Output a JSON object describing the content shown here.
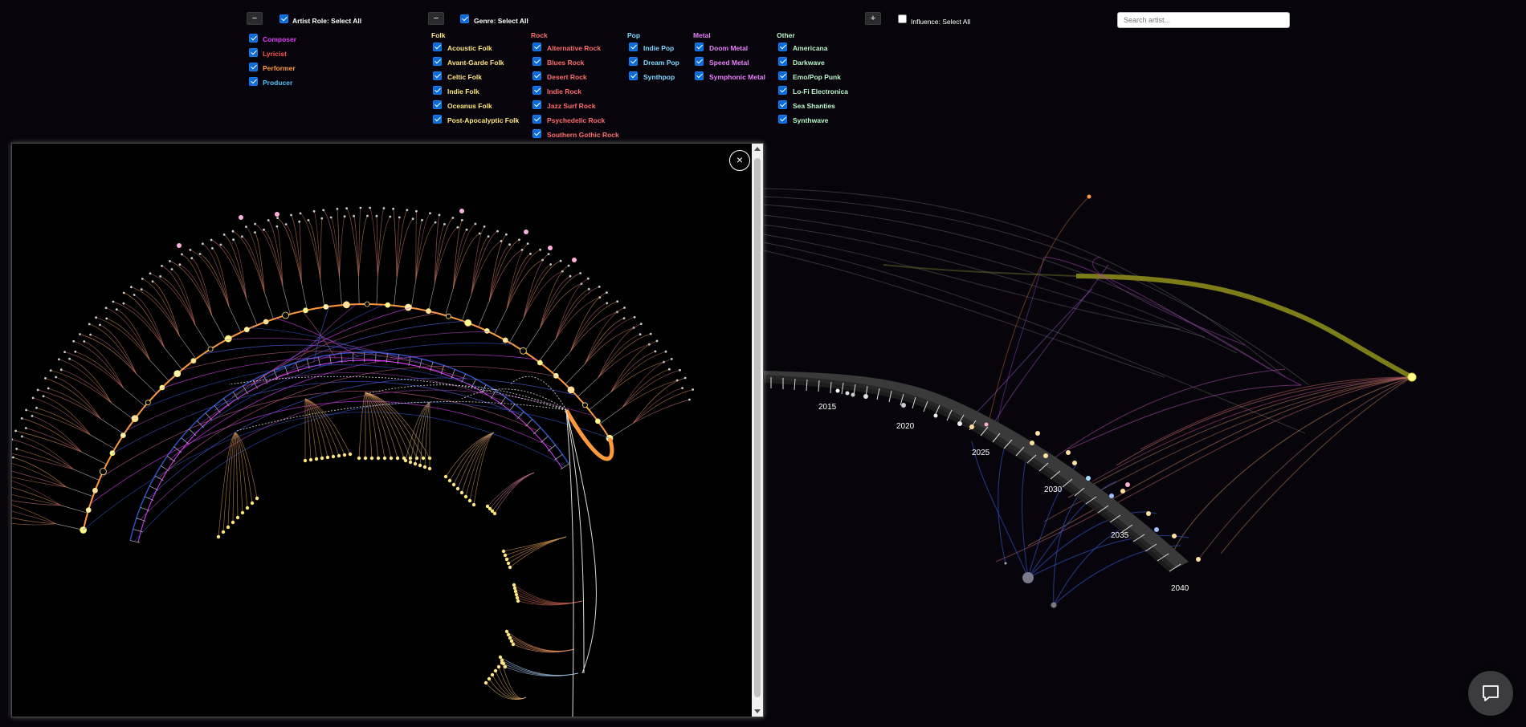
{
  "artist_role": {
    "collapse_label": "−",
    "select_all_label": "Artist Role: Select All",
    "items": [
      {
        "label": "Composer",
        "color": "#e040fb"
      },
      {
        "label": "Lyricist",
        "color": "#ff5252"
      },
      {
        "label": "Performer",
        "color": "#ff9a3c"
      },
      {
        "label": "Producer",
        "color": "#4fc3f7"
      }
    ]
  },
  "genre": {
    "collapse_label": "−",
    "select_all_label": "Genre: Select All",
    "groups": [
      {
        "name": "Folk",
        "color": "#ffe57f",
        "items": [
          "Acoustic Folk",
          "Avant-Garde Folk",
          "Celtic Folk",
          "Indie Folk",
          "Oceanus Folk",
          "Post-Apocalyptic Folk"
        ]
      },
      {
        "name": "Rock",
        "color": "#ff6e6e",
        "items": [
          "Alternative Rock",
          "Blues Rock",
          "Desert Rock",
          "Indie Rock",
          "Jazz Surf Rock",
          "Psychedelic Rock",
          "Southern Gothic Rock"
        ]
      },
      {
        "name": "Pop",
        "color": "#80d8ff",
        "items": [
          "Indie Pop",
          "Dream Pop",
          "Synthpop"
        ]
      },
      {
        "name": "Metal",
        "color": "#ea80fc",
        "items": [
          "Doom Metal",
          "Speed Metal",
          "Symphonic Metal"
        ]
      },
      {
        "name": "Other",
        "color": "#b9f6ca",
        "items": [
          "Americana",
          "Darkwave",
          "Emo/Pop Punk",
          "Lo-Fi Electronica",
          "Sea Shanties",
          "Synthwave"
        ]
      }
    ]
  },
  "influence": {
    "expand_label": "+",
    "select_all_label": "Influence: Select All",
    "checked": false
  },
  "search": {
    "placeholder": "Search artist..."
  },
  "timeline": {
    "years": [
      "2015",
      "2020",
      "2025",
      "2030",
      "2035",
      "2040"
    ]
  },
  "modal": {
    "close_label": "×"
  },
  "colors": {
    "background": "#07050b",
    "checkbox": "#0b6bd6",
    "highlight_node": "#ffff8d",
    "influence_band": "#8a8a1a"
  },
  "icons": {
    "chat": "chat-bubble-icon",
    "close": "close-icon"
  }
}
